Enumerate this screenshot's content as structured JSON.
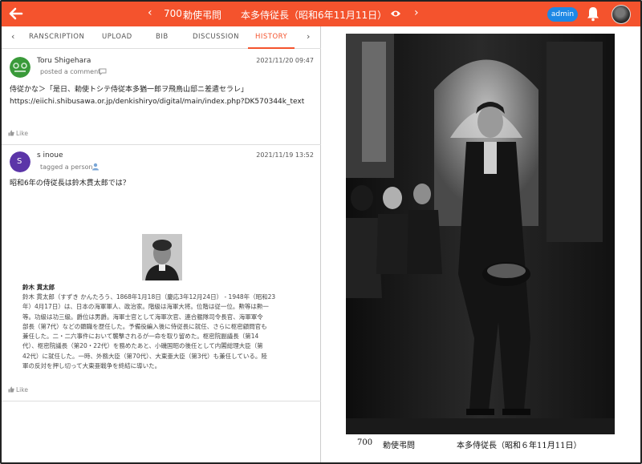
{
  "header": {
    "page_number": "700",
    "page_title": "勅使弔問",
    "page_subtitle": "本多侍従長（昭和6年11月11日）",
    "admin_label": "admin"
  },
  "tabs": [
    {
      "label": "RANSCRIPTION"
    },
    {
      "label": "UPLOAD"
    },
    {
      "label": "BIB"
    },
    {
      "label": "DISCUSSION"
    },
    {
      "label": "HISTORY"
    }
  ],
  "posts": [
    {
      "author": "Toru Shigehara",
      "action": "posted a comment",
      "date": "2021/11/20 09:47",
      "line1": "侍従かな＞「是日、勅使トシテ侍従本多猶一郎ヲ飛鳥山邸ニ差遣セラレ」",
      "line2": "https://eiichi.shibusawa.or.jp/denkishiryo/digital/main/index.php?DK570344k_text",
      "like": "Like"
    },
    {
      "author": "s inoue",
      "avatar_letter": "S",
      "action": "tagged a person",
      "date": "2021/11/19 13:52",
      "line1": "昭和6年の侍従長は鈴木貫太郎では？",
      "like": "Like"
    }
  ],
  "bio": {
    "heading": "鈴木 貫太郎",
    "lines": [
      "鈴木 貫太郎（すずき かんたろう、1868年1月18日（慶応3年12月24日） - 1948年（昭和23",
      "年）4月17日）は、日本の海軍軍人、政治家。階級は海軍大将。位階は従一位。勲等は勲一",
      "等。功級は功三級。爵位は男爵。海軍士官として海軍次官、連合艦隊司令長官、海軍軍令",
      "部長（第7代）などの顕職を歴任した。予備役編入後に侍従長に就任、さらに枢密顧問官も",
      "兼任した。二・二六事件において襲撃されるが一命を取り留めた。枢密院副議長（第14",
      "代）、枢密院議長（第20・22代）を務めたあと、小磯国昭の後任として内閣総理大臣（第",
      "42代）に就任した。一時、外務大臣（第70代）、大東亜大臣（第3代）も兼任している。陸",
      "軍の反対を押し切って大東亜戦争を終結に導いた。"
    ]
  },
  "viewer": {
    "caption_number": "700",
    "caption_title": "勅使弔問",
    "caption_subtitle": "本多侍従長（昭和６年11月11日）"
  },
  "colors": {
    "accent": "#f4532d",
    "admin_badge": "#1e88e5",
    "avatar_s": "#5b35a8",
    "avatar_toru": "#3a9a3a"
  },
  "icons": [
    "back-arrow-icon",
    "chevron-left-icon",
    "chevron-right-icon",
    "eye-icon",
    "bell-icon",
    "comment-icon",
    "person-icon",
    "thumbs-up-icon"
  ]
}
